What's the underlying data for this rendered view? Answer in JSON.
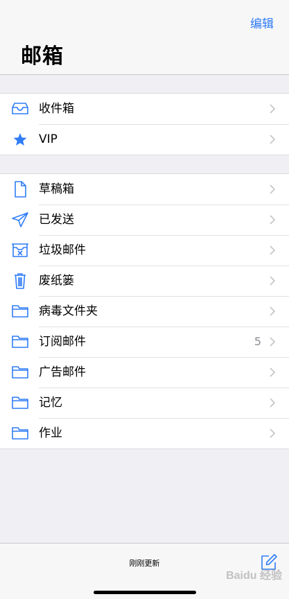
{
  "header": {
    "edit_label": "编辑",
    "title": "邮箱"
  },
  "groups": [
    {
      "items": [
        {
          "label": "收件箱",
          "icon": "inbox-icon"
        },
        {
          "label": "VIP",
          "icon": "star-icon"
        }
      ]
    },
    {
      "items": [
        {
          "label": "草稿箱",
          "icon": "document-icon"
        },
        {
          "label": "已发送",
          "icon": "paper-plane-icon"
        },
        {
          "label": "垃圾邮件",
          "icon": "junk-box-icon"
        },
        {
          "label": "废纸篓",
          "icon": "trash-icon"
        },
        {
          "label": "病毒文件夹",
          "icon": "folder-icon"
        },
        {
          "label": "订阅邮件",
          "icon": "folder-icon",
          "count": "5"
        },
        {
          "label": "广告邮件",
          "icon": "folder-icon"
        },
        {
          "label": "记忆",
          "icon": "folder-icon"
        },
        {
          "label": "作业",
          "icon": "folder-icon"
        }
      ]
    }
  ],
  "toolbar": {
    "status": "刚刚更新",
    "compose_icon": "compose-icon"
  },
  "watermark": "Baidu 经验",
  "colors": {
    "accent": "#2f7cf6",
    "background": "#efeff4",
    "separator": "#e1e1e6",
    "chevron": "#c7c7cc"
  }
}
